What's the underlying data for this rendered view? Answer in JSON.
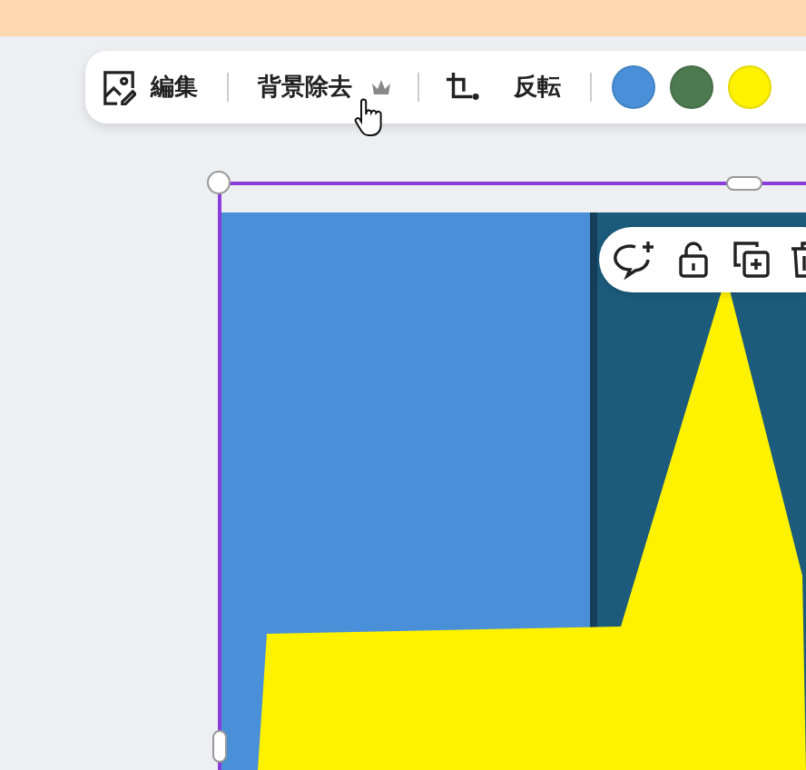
{
  "toolbar": {
    "edit_button": {
      "label": "編集"
    },
    "background_remove_button": {
      "label": "背景除去"
    },
    "flip_button": {
      "label": "反転"
    },
    "swatches": [
      {
        "color": "#4a90d9"
      },
      {
        "color": "#4e7a50"
      },
      {
        "color": "#fff200"
      }
    ]
  }
}
